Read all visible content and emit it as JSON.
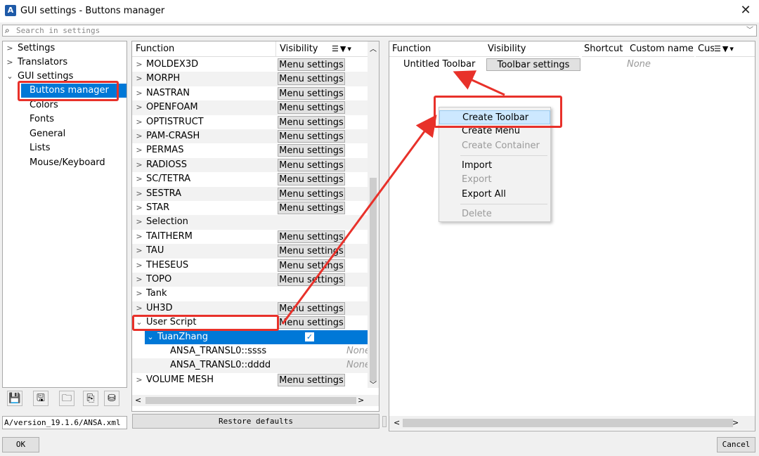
{
  "window": {
    "title": "GUI settings - Buttons manager",
    "icon": "ansa-app-icon",
    "close": "✕"
  },
  "search": {
    "placeholder": "Search in settings",
    "icon": "search-icon"
  },
  "left_tree": {
    "items": [
      {
        "label": "Settings",
        "state": "collapsed"
      },
      {
        "label": "Translators",
        "state": "collapsed"
      },
      {
        "label": "GUI settings",
        "state": "expanded"
      },
      {
        "label": "Buttons manager",
        "selected": true
      },
      {
        "label": "Colors"
      },
      {
        "label": "Fonts"
      },
      {
        "label": "General"
      },
      {
        "label": "Lists"
      },
      {
        "label": "Mouse/Keyboard"
      }
    ]
  },
  "left_toolbar": {
    "icons": [
      "save-icon",
      "save-as-icon",
      "open-folder-icon",
      "copy-icon",
      "database-icon"
    ]
  },
  "path_field": {
    "value": "A/version_19.1.6/ANSA.xml"
  },
  "functions_list": {
    "columns": [
      "Function",
      "Visibility"
    ],
    "header_icons": [
      "sort-icon",
      "filter-icon",
      "dropdown-icon"
    ],
    "rows": [
      {
        "name": "MOLDEX3D",
        "button": "Menu settings"
      },
      {
        "name": "MORPH",
        "button": "Menu settings"
      },
      {
        "name": "NASTRAN",
        "button": "Menu settings"
      },
      {
        "name": "OPENFOAM",
        "button": "Menu settings"
      },
      {
        "name": "OPTISTRUCT",
        "button": "Menu settings"
      },
      {
        "name": "PAM-CRASH",
        "button": "Menu settings"
      },
      {
        "name": "PERMAS",
        "button": "Menu settings"
      },
      {
        "name": "RADIOSS",
        "button": "Menu settings"
      },
      {
        "name": "SC/TETRA",
        "button": "Menu settings"
      },
      {
        "name": "SESTRA",
        "button": "Menu settings"
      },
      {
        "name": "STAR",
        "button": "Menu settings"
      },
      {
        "name": "Selection",
        "button": ""
      },
      {
        "name": "TAITHERM",
        "button": "Menu settings"
      },
      {
        "name": "TAU",
        "button": "Menu settings"
      },
      {
        "name": "THESEUS",
        "button": "Menu settings"
      },
      {
        "name": "TOPO",
        "button": "Menu settings"
      },
      {
        "name": "Tank",
        "button": ""
      },
      {
        "name": "UH3D",
        "button": "Menu settings"
      },
      {
        "name": "User Script",
        "button": "Menu settings",
        "expanded": true
      },
      {
        "name": "TuanZhang",
        "button": "",
        "selected": true,
        "checked": true
      },
      {
        "name": "ANSA_TRANSL0::ssss",
        "button": "",
        "shortcut": "None"
      },
      {
        "name": "ANSA_TRANSL0::dddd",
        "button": "",
        "shortcut": "None"
      },
      {
        "name": "VOLUME MESH",
        "button": "Menu settings"
      }
    ]
  },
  "restore_button": "Restore defaults",
  "toolbars_list": {
    "columns": [
      "Function",
      "Visibility",
      "Shortcut",
      "Custom name",
      "Cust"
    ],
    "rows": [
      {
        "name": "Untitled Toolbar",
        "button": "Toolbar settings",
        "custom_name": "None"
      }
    ]
  },
  "context_menu": {
    "items": [
      {
        "label": "Create Toolbar",
        "enabled": true,
        "highlighted": true
      },
      {
        "label": "Create Menu",
        "enabled": true
      },
      {
        "label": "Create Container",
        "enabled": false
      },
      {
        "label": "Import",
        "enabled": true
      },
      {
        "label": "Export",
        "enabled": false
      },
      {
        "label": "Export All",
        "enabled": true
      },
      {
        "label": "Delete",
        "enabled": false
      }
    ]
  },
  "footer": {
    "ok": "OK",
    "cancel": "Cancel"
  },
  "colors": {
    "selection": "#0078d7",
    "annotation": "#e8312a",
    "menu_highlight": "#cde8ff"
  }
}
